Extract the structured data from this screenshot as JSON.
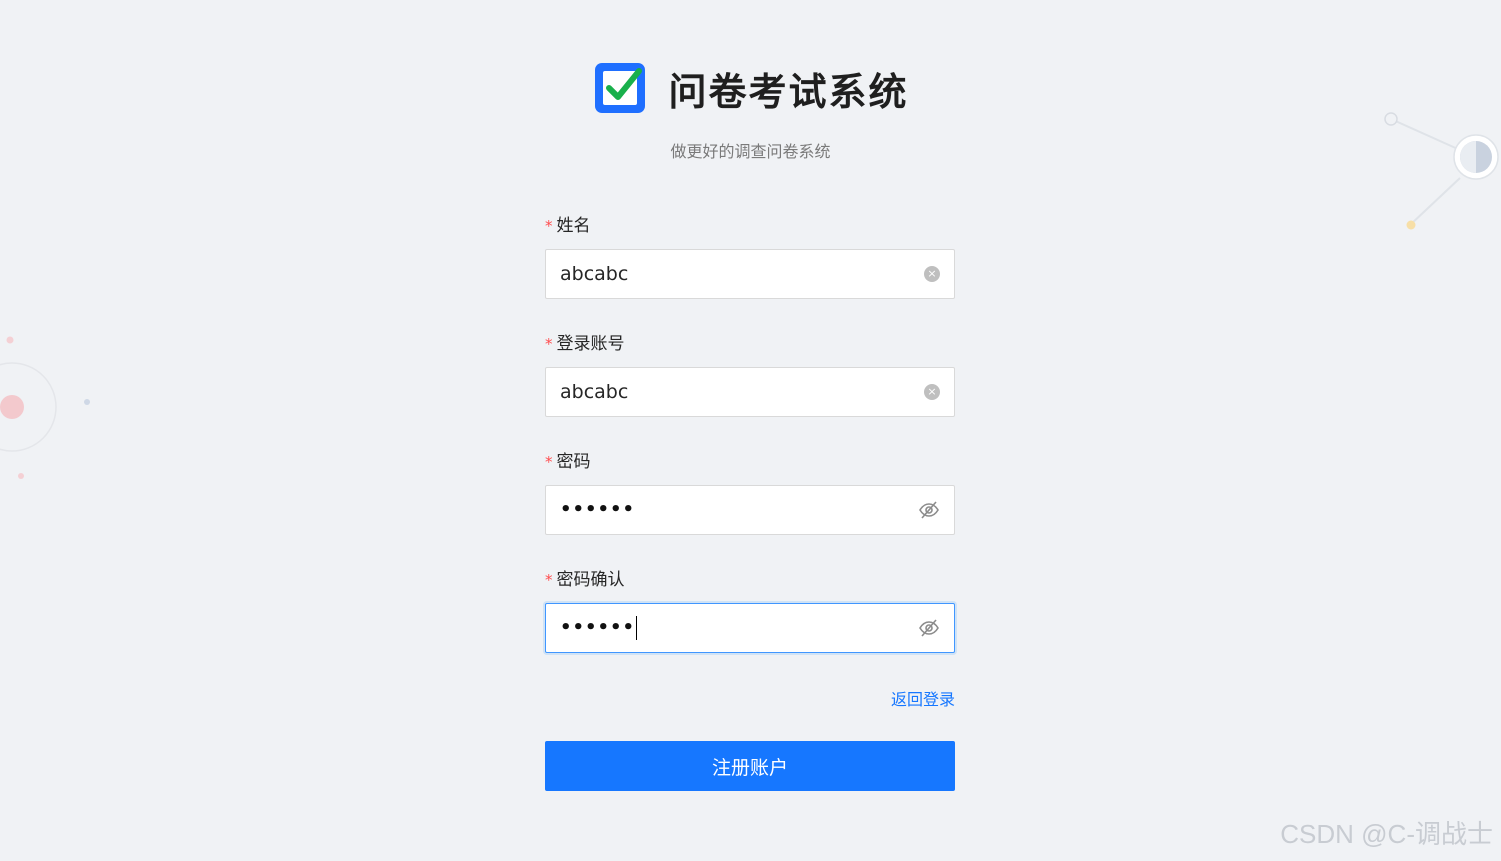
{
  "header": {
    "title": "问卷考试系统",
    "subtitle": "做更好的调查问卷系统"
  },
  "form": {
    "fields": [
      {
        "label": "姓名",
        "required_mark": "*",
        "value": "abcabc",
        "type": "text",
        "icon": "clear-icon"
      },
      {
        "label": "登录账号",
        "required_mark": "*",
        "value": "abcabc",
        "type": "text",
        "icon": "clear-icon"
      },
      {
        "label": "密码",
        "required_mark": "*",
        "value": "••••••",
        "type": "password",
        "icon": "eye-off-icon"
      },
      {
        "label": "密码确认",
        "required_mark": "*",
        "value": "••••••",
        "type": "password",
        "icon": "eye-off-icon",
        "focused": true
      }
    ],
    "back_link": "返回登录",
    "submit_label": "注册账户"
  },
  "watermark": "CSDN @C-调战士",
  "colors": {
    "primary": "#1677ff",
    "required": "#ff4d4f",
    "background": "#f0f2f5",
    "logo_blue": "#1f6fff",
    "logo_check": "#19b04b"
  }
}
